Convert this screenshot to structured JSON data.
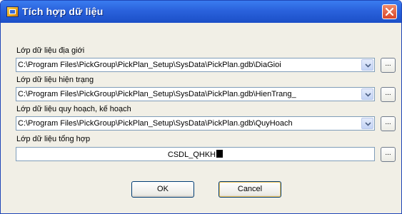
{
  "window": {
    "title": "Tích hợp dữ liệu"
  },
  "fields": [
    {
      "label": "Lớp dữ liệu địa giới",
      "value": "C:\\Program Files\\PickGroup\\PickPlan_Setup\\SysData\\PickPlan.gdb\\DiaGioi",
      "browse_label": "..."
    },
    {
      "label": "Lớp dữ liệu hiện trạng",
      "value": "C:\\Program Files\\PickGroup\\PickPlan_Setup\\SysData\\PickPlan.gdb\\HienTrang_",
      "browse_label": "..."
    },
    {
      "label": "Lớp dữ liệu quy hoạch, kế hoạch",
      "value": "C:\\Program Files\\PickGroup\\PickPlan_Setup\\SysData\\PickPlan.gdb\\QuyHoach",
      "browse_label": "..."
    },
    {
      "label": "Lớp dữ liệu tổng hợp",
      "value": "CSDL_QHKH",
      "browse_label": "..."
    }
  ],
  "buttons": {
    "ok_label": "OK",
    "cancel_label": "Cancel"
  }
}
